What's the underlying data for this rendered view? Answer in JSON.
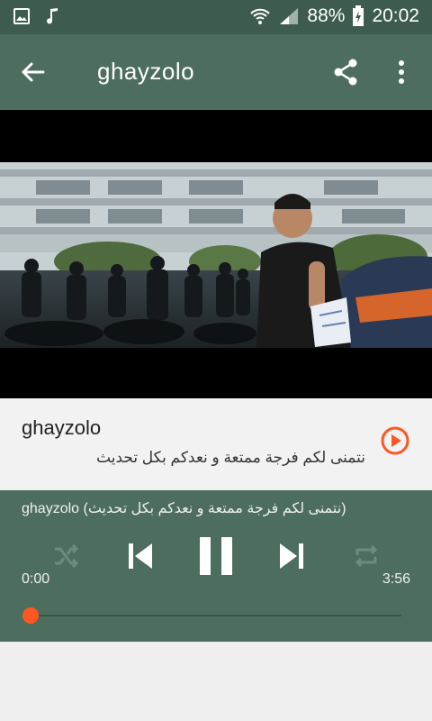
{
  "status_bar": {
    "battery": "88%",
    "time": "20:02",
    "icons": [
      "image-icon",
      "music-icon",
      "wifi-icon",
      "signal-icon",
      "battery-icon"
    ]
  },
  "appbar": {
    "title": "ghayzolo",
    "icons": [
      "back-arrow-icon",
      "share-icon",
      "more-vert-icon"
    ]
  },
  "track": {
    "title": "ghayzolo",
    "subtitle": "نتمنى لكم فرجة ممتعة و نعدكم بكل تحديث",
    "play_icon": "play-circle-icon"
  },
  "player": {
    "now_playing": "ghayzolo (نتمنى لكم فرجة ممتعة و نعدكم بكل تحديث)",
    "elapsed": "0:00",
    "duration": "3:56",
    "progress": 0.0,
    "controls": [
      "shuffle-icon",
      "previous-icon",
      "pause-icon",
      "next-icon",
      "repeat-icon"
    ]
  },
  "colors": {
    "status_bar": "#3d5c4f",
    "app_bar": "#4d6e5f",
    "accent": "#ff5722",
    "card": "#f2f2f2"
  }
}
